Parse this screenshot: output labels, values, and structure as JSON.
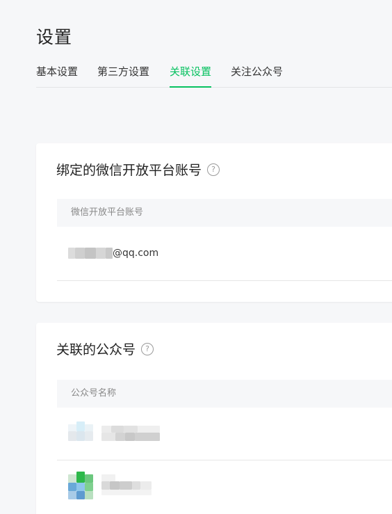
{
  "page_title": "设置",
  "tabs": [
    {
      "label": "基本设置",
      "active": false
    },
    {
      "label": "第三方设置",
      "active": false
    },
    {
      "label": "关联设置",
      "active": true
    },
    {
      "label": "关注公众号",
      "active": false
    }
  ],
  "colors": {
    "accent": "#07c160",
    "background": "#f6f7f9",
    "card": "#ffffff"
  },
  "binding_card": {
    "title": "绑定的微信开放平台账号",
    "help_icon": "?",
    "column_header": "微信开放平台账号",
    "account_suffix": "@qq.com"
  },
  "linked_card": {
    "title": "关联的公众号",
    "help_icon": "?",
    "column_header": "公众号名称"
  }
}
